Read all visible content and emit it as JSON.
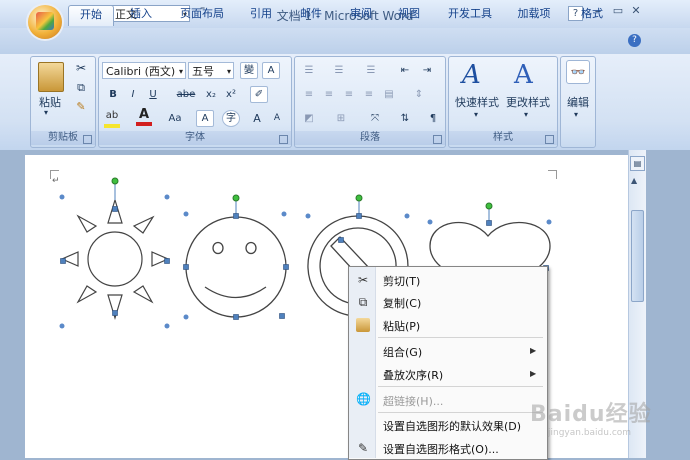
{
  "window": {
    "title": "文档 1 - Microsoft Word"
  },
  "quick_access": {
    "style_value": "正文",
    "icons": [
      "save-icon",
      "print-preview-icon"
    ]
  },
  "window_controls": {
    "help": "?",
    "minimize": "–",
    "restore": "▭",
    "close": "✕"
  },
  "tabs": [
    "开始",
    "插入",
    "页面布局",
    "引用",
    "邮件",
    "审阅",
    "视图",
    "开发工具",
    "加载项",
    "格式"
  ],
  "active_tab": "开始",
  "ribbon": {
    "clipboard": {
      "label": "剪贴板",
      "paste_label": "粘贴"
    },
    "font": {
      "label": "字体",
      "font_name": "Calibri (西文)",
      "font_size": "五号",
      "buttons": [
        "B",
        "I",
        "U",
        "abe",
        "x₂",
        "x²",
        "A",
        "Aa",
        "A",
        "A",
        "A"
      ]
    },
    "paragraph": {
      "label": "段落"
    },
    "styles": {
      "label": "样式",
      "quick_styles": "快速样式",
      "change_styles": "更改样式"
    },
    "editing": {
      "label": "编辑",
      "button": "编辑"
    }
  },
  "context_menu": {
    "items": [
      {
        "label": "剪切(T)",
        "icon": "scissors-icon",
        "enabled": true,
        "submenu": false
      },
      {
        "label": "复制(C)",
        "icon": "copy-icon",
        "enabled": true,
        "submenu": false
      },
      {
        "label": "粘贴(P)",
        "icon": "paste-icon",
        "enabled": true,
        "submenu": false
      },
      {
        "label": "组合(G)",
        "icon": "",
        "enabled": true,
        "submenu": true
      },
      {
        "label": "叠放次序(R)",
        "icon": "",
        "enabled": true,
        "submenu": true
      },
      {
        "label": "超链接(H)...",
        "icon": "hyperlink-icon",
        "enabled": false,
        "submenu": false
      },
      {
        "label": "设置自选图形的默认效果(D)",
        "icon": "",
        "enabled": true,
        "submenu": false
      },
      {
        "label": "设置自选图形格式(O)...",
        "icon": "format-shape-icon",
        "enabled": true,
        "submenu": false
      }
    ]
  },
  "shapes": [
    "sun",
    "smiley-face",
    "no-symbol",
    "heart"
  ],
  "watermark": {
    "text": "Baidu经验",
    "sub": "jingyan.baidu.com"
  }
}
